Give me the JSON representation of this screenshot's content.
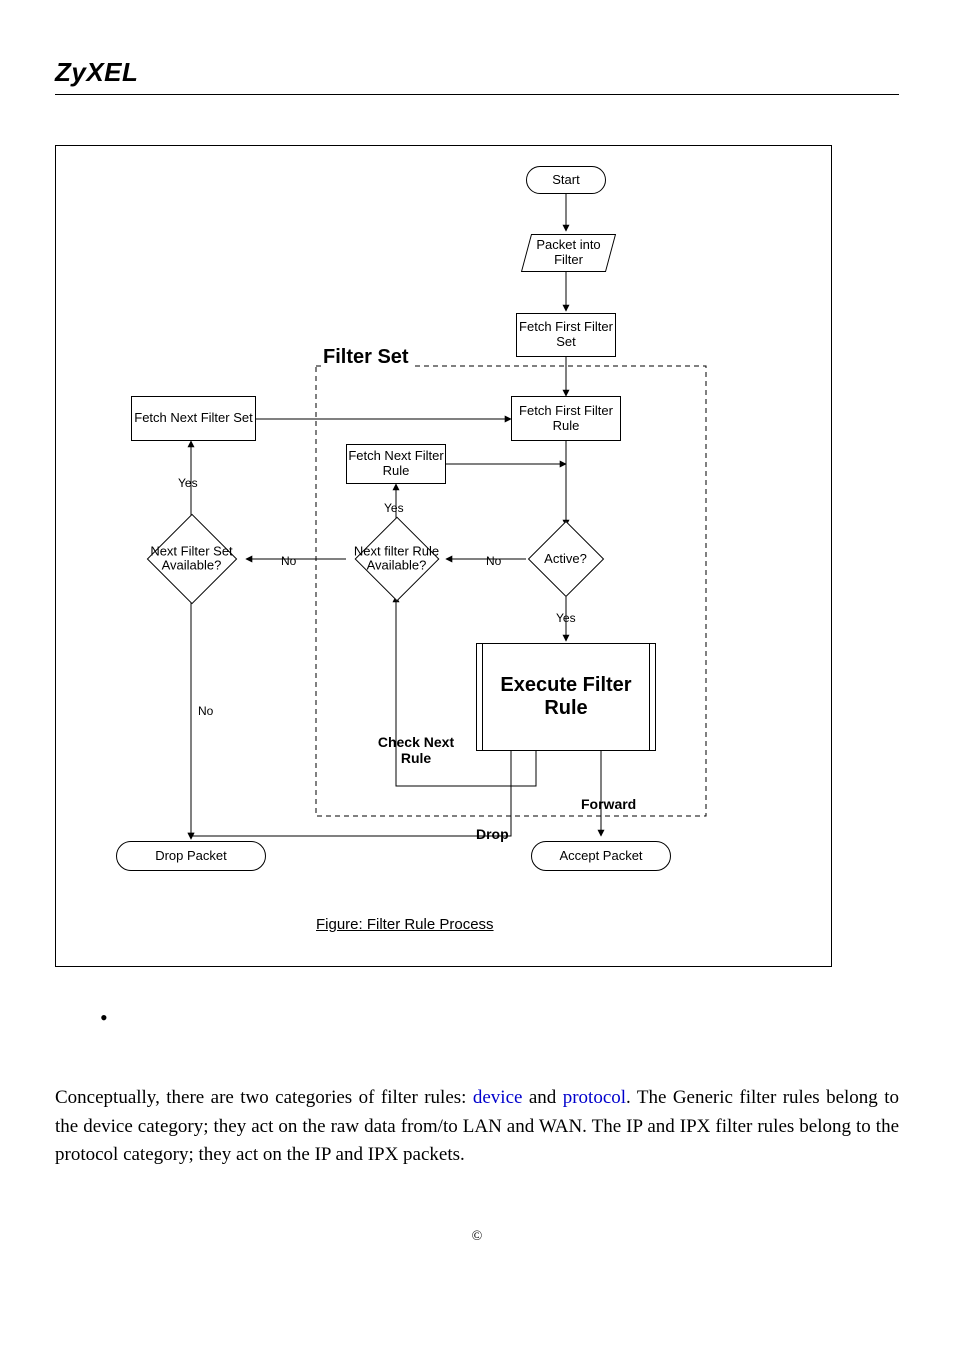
{
  "brand": "ZyXEL",
  "diagram": {
    "start": "Start",
    "packet_in": "Packet into Filter",
    "fetch_first_set": "Fetch First Filter Set",
    "filter_set_title": "Filter Set",
    "fetch_first_rule": "Fetch First Filter Rule",
    "fetch_next_set": "Fetch Next Filter Set",
    "fetch_next_rule": "Fetch Next Filter Rule",
    "next_set_avail": "Next Filter Set Available?",
    "next_rule_avail": "Next filter Rule Available?",
    "active": "Active?",
    "execute": "Execute Filter Rule",
    "check_next": "Check Next Rule",
    "drop_packet": "Drop Packet",
    "accept_packet": "Accept Packet",
    "forward": "Forward",
    "drop": "Drop",
    "yes": "Yes",
    "no": "No",
    "caption": "Figure: Filter Rule Process"
  },
  "body": {
    "pre": "Conceptually, there are two categories of filter rules: ",
    "link1": "device",
    "mid1": " and ",
    "link2": "protocol",
    "post": ". The Generic filter rules belong to the device category; they act on the raw data from/to LAN and WAN. The IP and IPX filter rules belong to the protocol category; they act on the IP and IPX packets."
  },
  "copyright": "©"
}
